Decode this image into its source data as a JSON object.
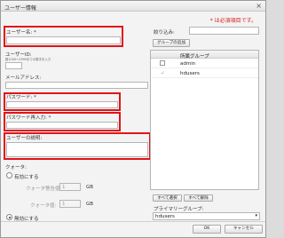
{
  "window": {
    "title": "ユーザー情報",
    "close_glyph": "×"
  },
  "required_note": "* は必須項目です。",
  "form": {
    "username_label": "ユーザー名: *",
    "uid_label": "ユーザーID:",
    "uid_hint": "数1000～2999までの数字を入力",
    "email_label": "メールアドレス:",
    "password_label": "パスワード: *",
    "password_confirm_label": "パスワード再入力: *",
    "description_label": "ユーザーの説明:"
  },
  "quota": {
    "label": "クォータ:",
    "enable_label": "有効にする",
    "limit_label": "クォータ警告値:",
    "limit_value": "1",
    "hard_label": "クォータ値:",
    "hard_value": "1",
    "unit": "GB",
    "disable_label": "無効にする"
  },
  "groups": {
    "filter_label": "絞り込み:",
    "add_button": "グループの追加",
    "column_header": "所属グループ",
    "items": [
      {
        "name": "admin",
        "checked": false
      },
      {
        "name": "hdusers",
        "checked": true
      }
    ],
    "select_all": "すべて選択",
    "deselect_all": "すべて解除",
    "primary_label": "プライマリーグループ:",
    "primary_value": "hdusers"
  },
  "footer": {
    "ok": "OK",
    "cancel": "キャンセル"
  },
  "colors": {
    "required": "#d62020",
    "highlight": "#e1141a"
  }
}
